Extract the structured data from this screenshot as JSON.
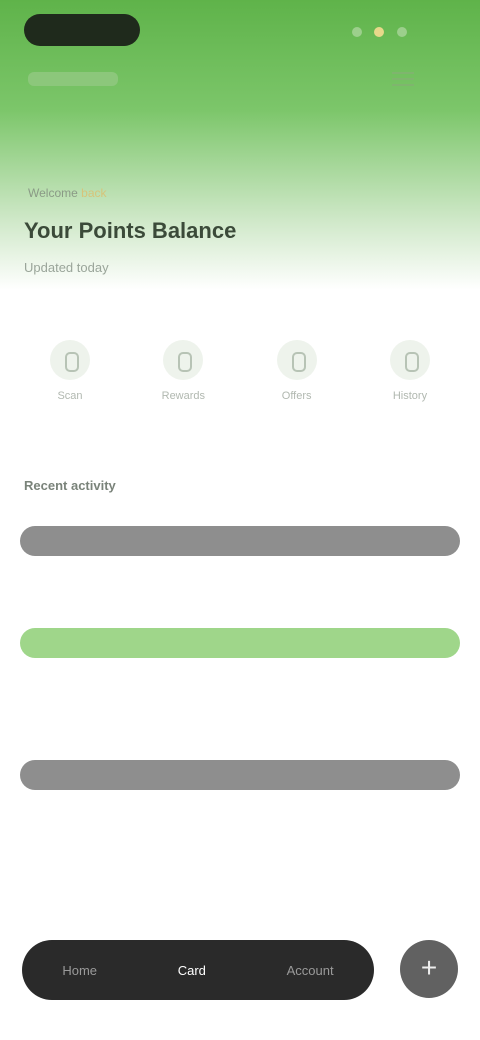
{
  "header": {
    "status_icons": [
      "signal-icon",
      "battery-icon",
      "notification-icon"
    ],
    "menu_icon": "hamburger-icon"
  },
  "hero": {
    "eyebrow_prefix": "Welcome",
    "eyebrow_highlight": "back",
    "title": "Your Points Balance",
    "subtitle": "Updated today"
  },
  "quick_actions": [
    {
      "icon": "scan-icon",
      "label": "Scan"
    },
    {
      "icon": "rewards-icon",
      "label": "Rewards"
    },
    {
      "icon": "offers-icon",
      "label": "Offers"
    },
    {
      "icon": "history-icon",
      "label": "History"
    }
  ],
  "activity": {
    "section_label": "Recent activity",
    "groups": [
      {
        "style": "gray",
        "label": "",
        "rows": [
          {
            "num": "",
            "name": "",
            "val": ""
          }
        ]
      },
      {
        "style": "green",
        "label": "",
        "rows": [
          {
            "num": "",
            "name": "",
            "val": ""
          },
          {
            "num": "",
            "name": "",
            "val": ""
          }
        ]
      },
      {
        "style": "gray",
        "label": "",
        "rows": [
          {
            "num": "",
            "name": "",
            "val": ""
          }
        ]
      }
    ]
  },
  "bottom_nav": {
    "segments": [
      "Home",
      "Card",
      "Account"
    ],
    "active_index": 1,
    "fab_symbol": "+"
  },
  "colors": {
    "brand_green": "#5fb34a",
    "accent_green": "#9fd68a",
    "nav_dark": "#2a2a2a",
    "fab_gray": "#616161"
  }
}
